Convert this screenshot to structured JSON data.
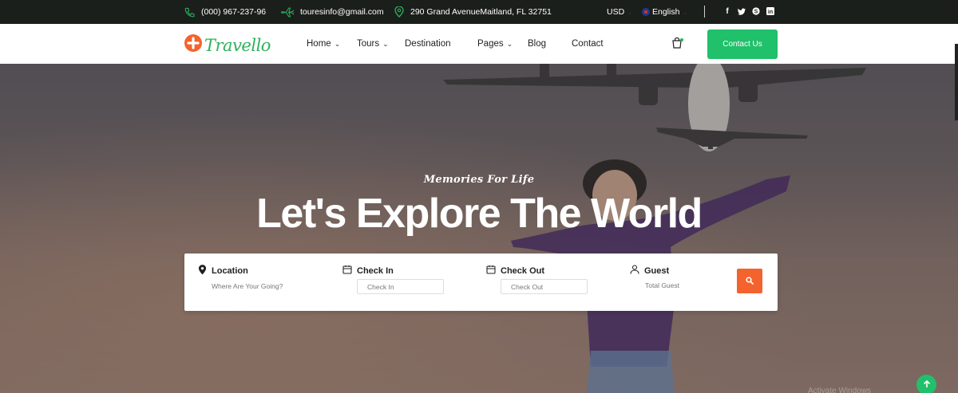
{
  "topbar": {
    "phone": "(000) 967-237-96",
    "email": "touresinfo@gmail.com",
    "address": "290 Grand AvenueMaitland, FL 32751",
    "currency": "USD",
    "language": "English",
    "social_icons": [
      "facebook-icon",
      "twitter-icon",
      "skype-icon",
      "linkedin-icon"
    ]
  },
  "nav": {
    "logo_text": "Travello",
    "items": [
      {
        "label": "Home"
      },
      {
        "label": "Tours"
      },
      {
        "label": "Destination"
      },
      {
        "label": "Pages"
      },
      {
        "label": "Blog"
      },
      {
        "label": "Contact"
      }
    ],
    "contact_button": "Contact Us"
  },
  "hero": {
    "tagline": "Memories For Life",
    "headline": "Let's Explore The World"
  },
  "search": {
    "location": {
      "label": "Location",
      "placeholder": "Where Are Your Going?"
    },
    "checkin": {
      "label": "Check In",
      "placeholder": "Check In"
    },
    "checkout": {
      "label": "Check Out",
      "placeholder": "Check Out"
    },
    "guest": {
      "label": "Guest",
      "placeholder": "Total Guest"
    }
  },
  "watermark": "Activate Windows",
  "colors": {
    "brand_green": "#21c06a",
    "accent_orange": "#f4632e",
    "topbar_bg": "#1b1f1c"
  }
}
